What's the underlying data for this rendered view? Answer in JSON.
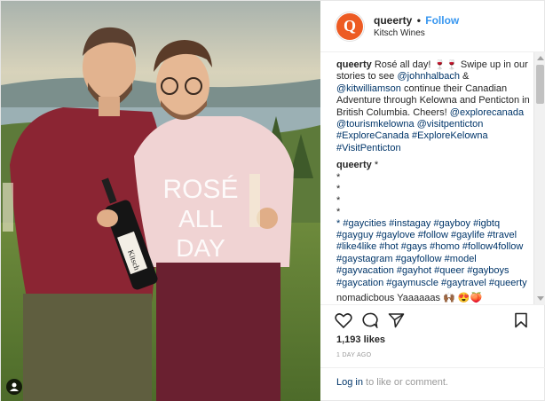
{
  "header": {
    "username": "queerty",
    "separator": "•",
    "follow_label": "Follow",
    "location": "Kitsch Wines",
    "avatar_letter": "Q"
  },
  "caption": {
    "username": "queerty",
    "text_1": "Rosé all day! 🍷🍷 Swipe up in our stories to see",
    "mention_1": "@johnhalbach",
    "text_2": "&",
    "mention_2": "@kitwilliamson",
    "text_3": "continue their Canadian Adventure through Kelowna and Penticton in British Columbia. Cheers!",
    "tags": "@explorecanada @tourismkelowna @visitpenticton #ExploreCanada #ExploreKelowna #VisitPenticton"
  },
  "comment2": {
    "username": "queerty",
    "line0": "*",
    "stars": [
      "*",
      "*",
      "*",
      "*"
    ],
    "hashtags": "* #gaycities #instagay #gayboy #igbtq #gayguy #gaylove #follow #gaylife #travel #like4like #hot #gays #homo #follow4follow #gaystagram #gayfollow #model #gayvacation #gayhot #queer #gayboys #gaycation #gaymuscle #gaytravel #queerty"
  },
  "partial_comment": "nomadicbous Yaaaaaas 🙌🏾 😍🍑",
  "likes": "1,193 likes",
  "date": "1 DAY AGO",
  "login": {
    "link": "Log in",
    "rest": "to like or comment."
  },
  "photo_shirt_text": [
    "ROSÉ",
    "ALL",
    "DAY"
  ],
  "photo_bottle_label": "Kitsch",
  "colors": {
    "follow_blue": "#3897f0",
    "link_blue": "#003569",
    "avatar_orange": "#ed5b23"
  }
}
